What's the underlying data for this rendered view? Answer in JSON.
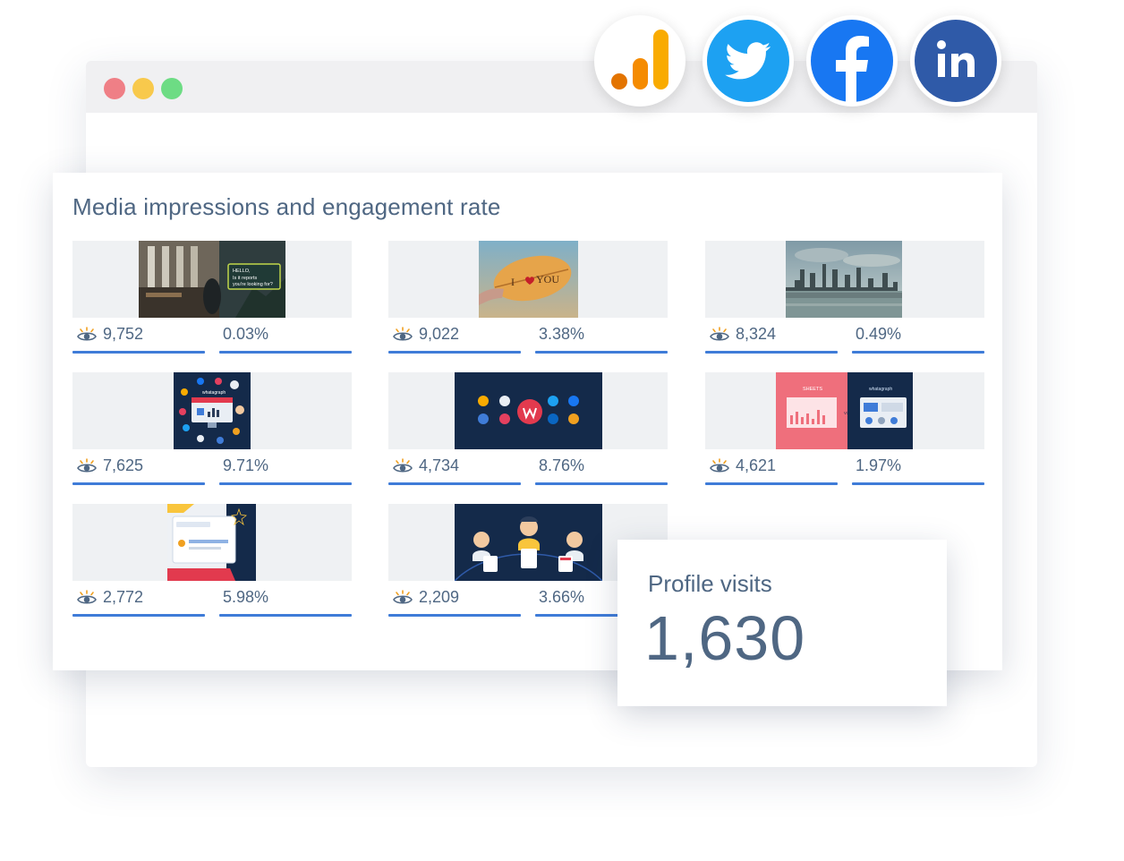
{
  "dashboard": {
    "title": "Media impressions and engagement rate",
    "posts": [
      {
        "impressions": "9,752",
        "engagement_rate": "0.03%",
        "thumbnail_text": [
          "HELLO,",
          "Is it reports",
          "you're looking for?"
        ]
      },
      {
        "impressions": "9,022",
        "engagement_rate": "3.38%",
        "thumbnail_text": [
          "I",
          "YOU"
        ]
      },
      {
        "impressions": "8,324",
        "engagement_rate": "0.49%"
      },
      {
        "impressions": "7,625",
        "engagement_rate": "9.71%",
        "thumbnail_text": [
          "whatagraph"
        ]
      },
      {
        "impressions": "4,734",
        "engagement_rate": "8.76%"
      },
      {
        "impressions": "4,621",
        "engagement_rate": "1.97%",
        "thumbnail_text": [
          "SHEETS",
          "VS",
          "whatagraph"
        ]
      },
      {
        "impressions": "2,772",
        "engagement_rate": "5.98%"
      },
      {
        "impressions": "2,209",
        "engagement_rate": "3.66%"
      }
    ]
  },
  "profile_visits": {
    "label": "Profile visits",
    "value": "1,630"
  },
  "integrations": [
    "google-analytics-icon",
    "twitter-icon",
    "facebook-icon",
    "linkedin-icon"
  ],
  "colors": {
    "accent": "#3f7cd8",
    "text": "#4f6783",
    "twitter": "#1da1f2",
    "facebook": "#1877f2",
    "linkedin": "#2f5aa8",
    "analytics": "#f9ab00"
  }
}
